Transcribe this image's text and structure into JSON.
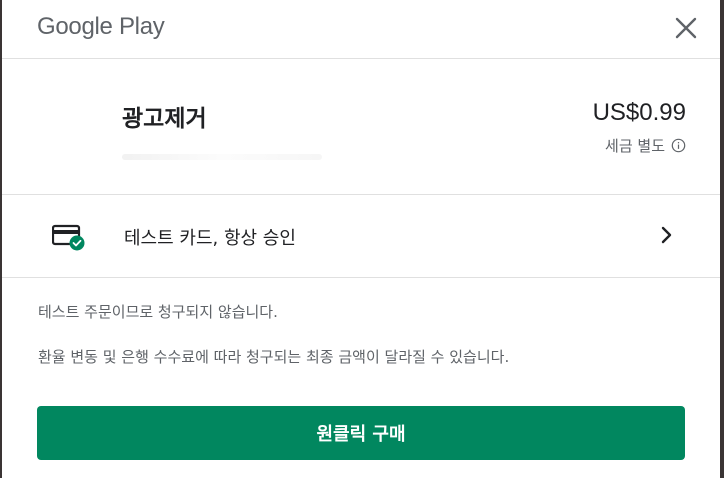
{
  "header": {
    "brand": "Google Play"
  },
  "product": {
    "title": "광고제거",
    "price": "US$0.99",
    "tax_note": "세금 별도"
  },
  "payment": {
    "method_label": "테스트 카드, 항상 승인"
  },
  "notices": {
    "test_order": "테스트 주문이므로 청구되지 않습니다.",
    "exchange": "환율 변동 및 은행 수수료에 따라 청구되는 최종 금액이 달라질 수 있습니다."
  },
  "actions": {
    "buy_label": "원클릭 구매"
  },
  "colors": {
    "accent": "#01875f",
    "text_primary": "#202124",
    "text_secondary": "#5f6368"
  },
  "icons": {
    "close": "close-icon",
    "info": "info-icon",
    "card": "credit-card-check-icon",
    "chevron": "chevron-right-icon"
  }
}
